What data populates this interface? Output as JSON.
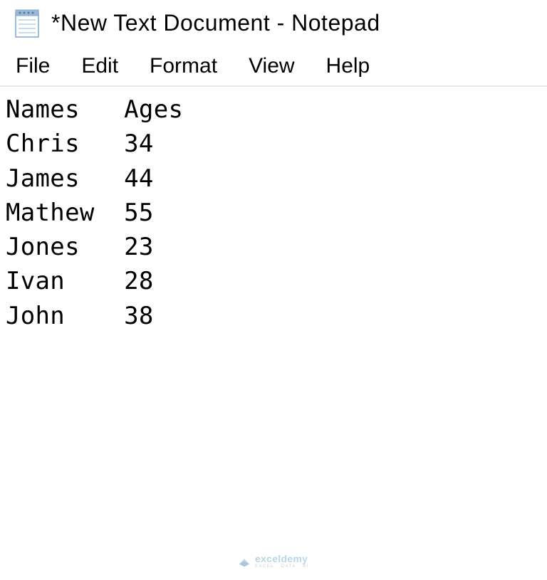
{
  "window": {
    "title": "*New Text Document - Notepad"
  },
  "menu": {
    "file": "File",
    "edit": "Edit",
    "format": "Format",
    "view": "View",
    "help": "Help"
  },
  "document": {
    "header": {
      "col1": "Names",
      "col2": "Ages"
    },
    "rows": [
      {
        "name": "Chris",
        "age": "34"
      },
      {
        "name": "James",
        "age": "44"
      },
      {
        "name": "Mathew",
        "age": "55"
      },
      {
        "name": "Jones",
        "age": "23"
      },
      {
        "name": "Ivan",
        "age": "28"
      },
      {
        "name": "John",
        "age": "38"
      }
    ],
    "tab_width": 8
  },
  "watermark": {
    "brand": "exceldemy",
    "tagline": "EXCEL · DATA · BI"
  }
}
